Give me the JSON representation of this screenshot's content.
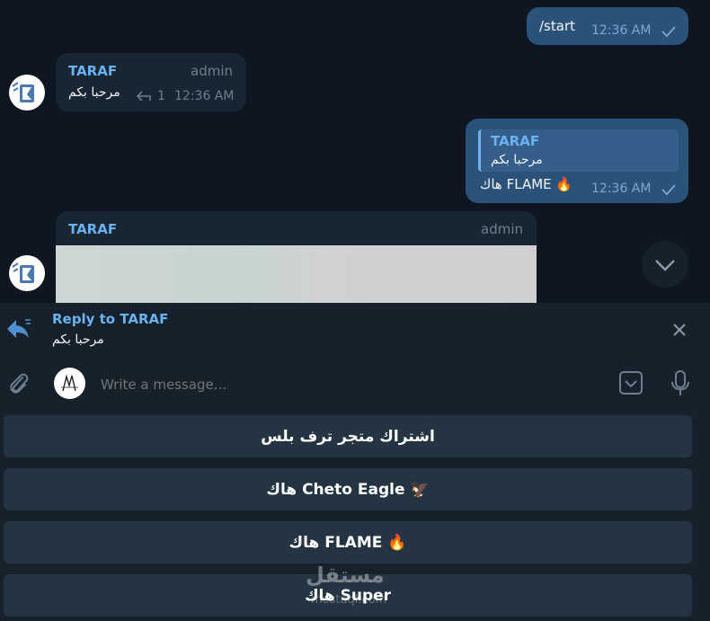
{
  "messages": {
    "start": {
      "text": "/start",
      "time": "12:36 AM"
    },
    "welcome": {
      "sender": "TARAF",
      "role": "admin",
      "text": "مرحبا بكم",
      "reply_count": "1",
      "time": "12:36 AM"
    },
    "reply_out": {
      "quoted_sender": "TARAF",
      "quoted_text": "مرحبا بكم",
      "text": "هاك FLAME 🔥",
      "time": "12:36 AM"
    },
    "media": {
      "sender": "TARAF",
      "role": "admin"
    }
  },
  "reply_bar": {
    "title": "Reply to TARAF",
    "text": "مرحبا بكم"
  },
  "composer": {
    "placeholder": "Write a message..."
  },
  "keyboard": {
    "buttons": [
      "اشتراك متجر ترف بلس",
      "هاك Cheto Eagle 🦅",
      "هاك FLAME 🔥",
      "هاك Super"
    ]
  },
  "watermark": {
    "text": "مستقل",
    "sub": "mostaql.com"
  },
  "colors": {
    "background": "#0e1621",
    "outgoing_bubble": "#2b5278",
    "incoming_bubble": "#182533",
    "accent": "#6ab3f3",
    "panel": "#17212b",
    "keyboard_button": "#243443"
  }
}
